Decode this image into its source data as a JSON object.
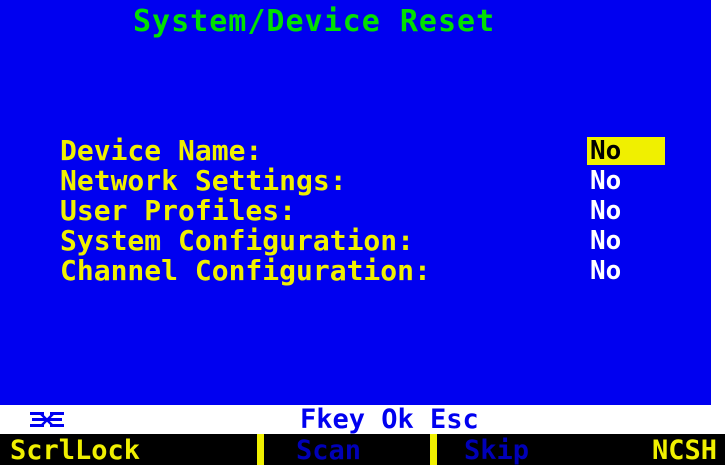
{
  "screen": {
    "title": "System/Device Reset"
  },
  "reset_options": [
    {
      "label": "Device Name:",
      "value": "No",
      "selected": true
    },
    {
      "label": "Network Settings:",
      "value": "No",
      "selected": false
    },
    {
      "label": "User Profiles:",
      "value": "No",
      "selected": false
    },
    {
      "label": "System Configuration:",
      "value": "No",
      "selected": false
    },
    {
      "label": "Channel Configuration:",
      "value": "No",
      "selected": false
    }
  ],
  "status_bar": {
    "icon": "network-logo-icon",
    "keys_hint": "Fkey Ok Esc"
  },
  "lock_keys": [
    {
      "label": "ScrlLock",
      "active": true
    },
    {
      "label": "Scan",
      "active": false
    },
    {
      "label": "Skip",
      "active": false
    },
    {
      "label": "NCSH",
      "active": true
    }
  ],
  "colors": {
    "background": "#0000f0",
    "title": "#00e000",
    "label": "#f0f000",
    "value": "#ffffff",
    "highlight": "#f0f000",
    "inactive_key": "#0000b8"
  }
}
